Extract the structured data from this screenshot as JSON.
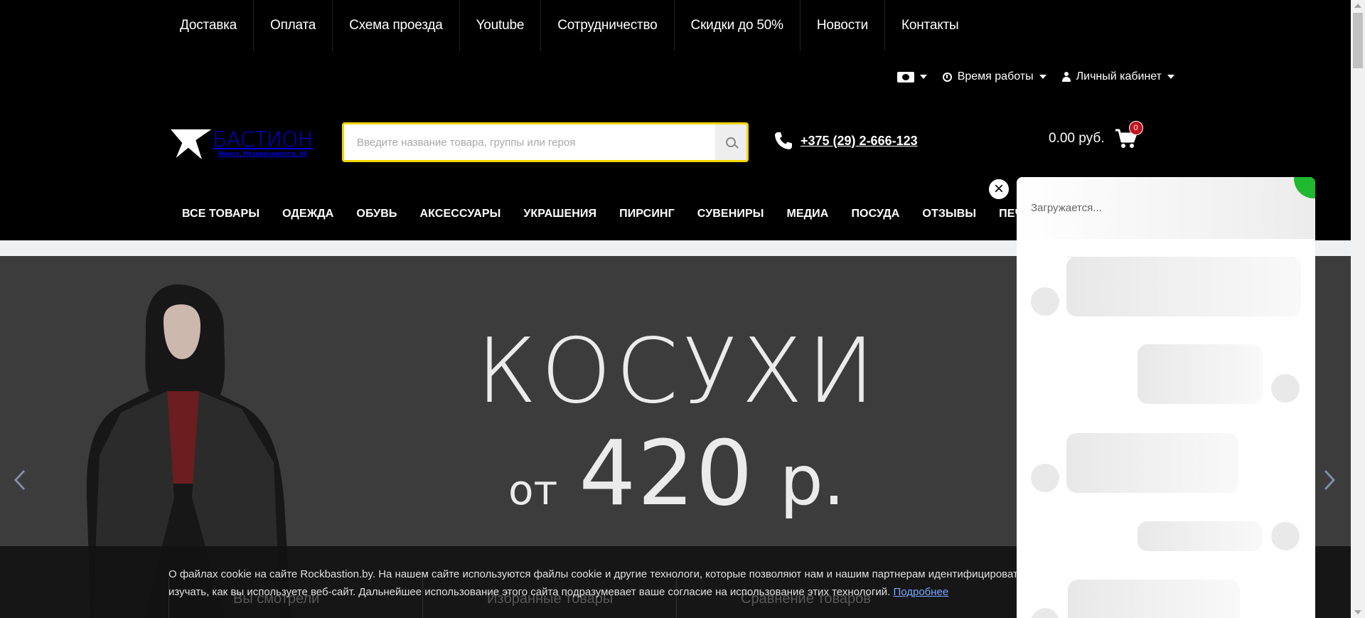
{
  "top_links": [
    "Доставка",
    "Оплата",
    "Схема проезда",
    "Youtube",
    "Сотрудничество",
    "Скидки до 50%",
    "Новости",
    "Контакты"
  ],
  "utility": {
    "currency_icon": "money-icon",
    "hours_label": "Время работы",
    "account_label": "Личный кабинет"
  },
  "logo": {
    "name": "БАСТИОН",
    "address": "Минск, Независимости, 44"
  },
  "search": {
    "placeholder": "Введите название товара, группы или героя",
    "value": ""
  },
  "phone": "+375 (29) 2-666-123",
  "cart": {
    "total": "0.00 руб.",
    "count": "0"
  },
  "main_nav": [
    "ВСЕ ТОВАРЫ",
    "ОДЕЖДА",
    "ОБУВЬ",
    "АКСЕССУАРЫ",
    "УКРАШЕНИЯ",
    "ПИРСИНГ",
    "СУВЕНИРЫ",
    "МЕДИА",
    "ПОСУДА",
    "ОТЗЫВЫ",
    "ПЕЧАТЬ"
  ],
  "banner": {
    "title": "КОСУХИ",
    "price_prefix": "от",
    "price": "420",
    "currency": "р."
  },
  "cookie": {
    "line1": "О файлах cookie на сайте Rockbastion.by. На нашем сайте используются файлы cookie и другие технологи, которые позволяют нам и нашим партнерам идентифицировать",
    "line2": "изучать, как вы используете веб-сайт. Дальнейшее использование этого сайта подразумевает ваше согласие на использование этих технологий.",
    "link": "Подробнее",
    "behind": [
      "Вы смотрели",
      "Избранные товары",
      "Сравнение товаров"
    ]
  },
  "chat": {
    "loading": "Загружается...",
    "close": "×"
  },
  "colors": {
    "search_border": "#f2d400",
    "badge": "#c1141d",
    "chat_accent": "#1fb830",
    "banner_bg": "#3c3c3d"
  }
}
